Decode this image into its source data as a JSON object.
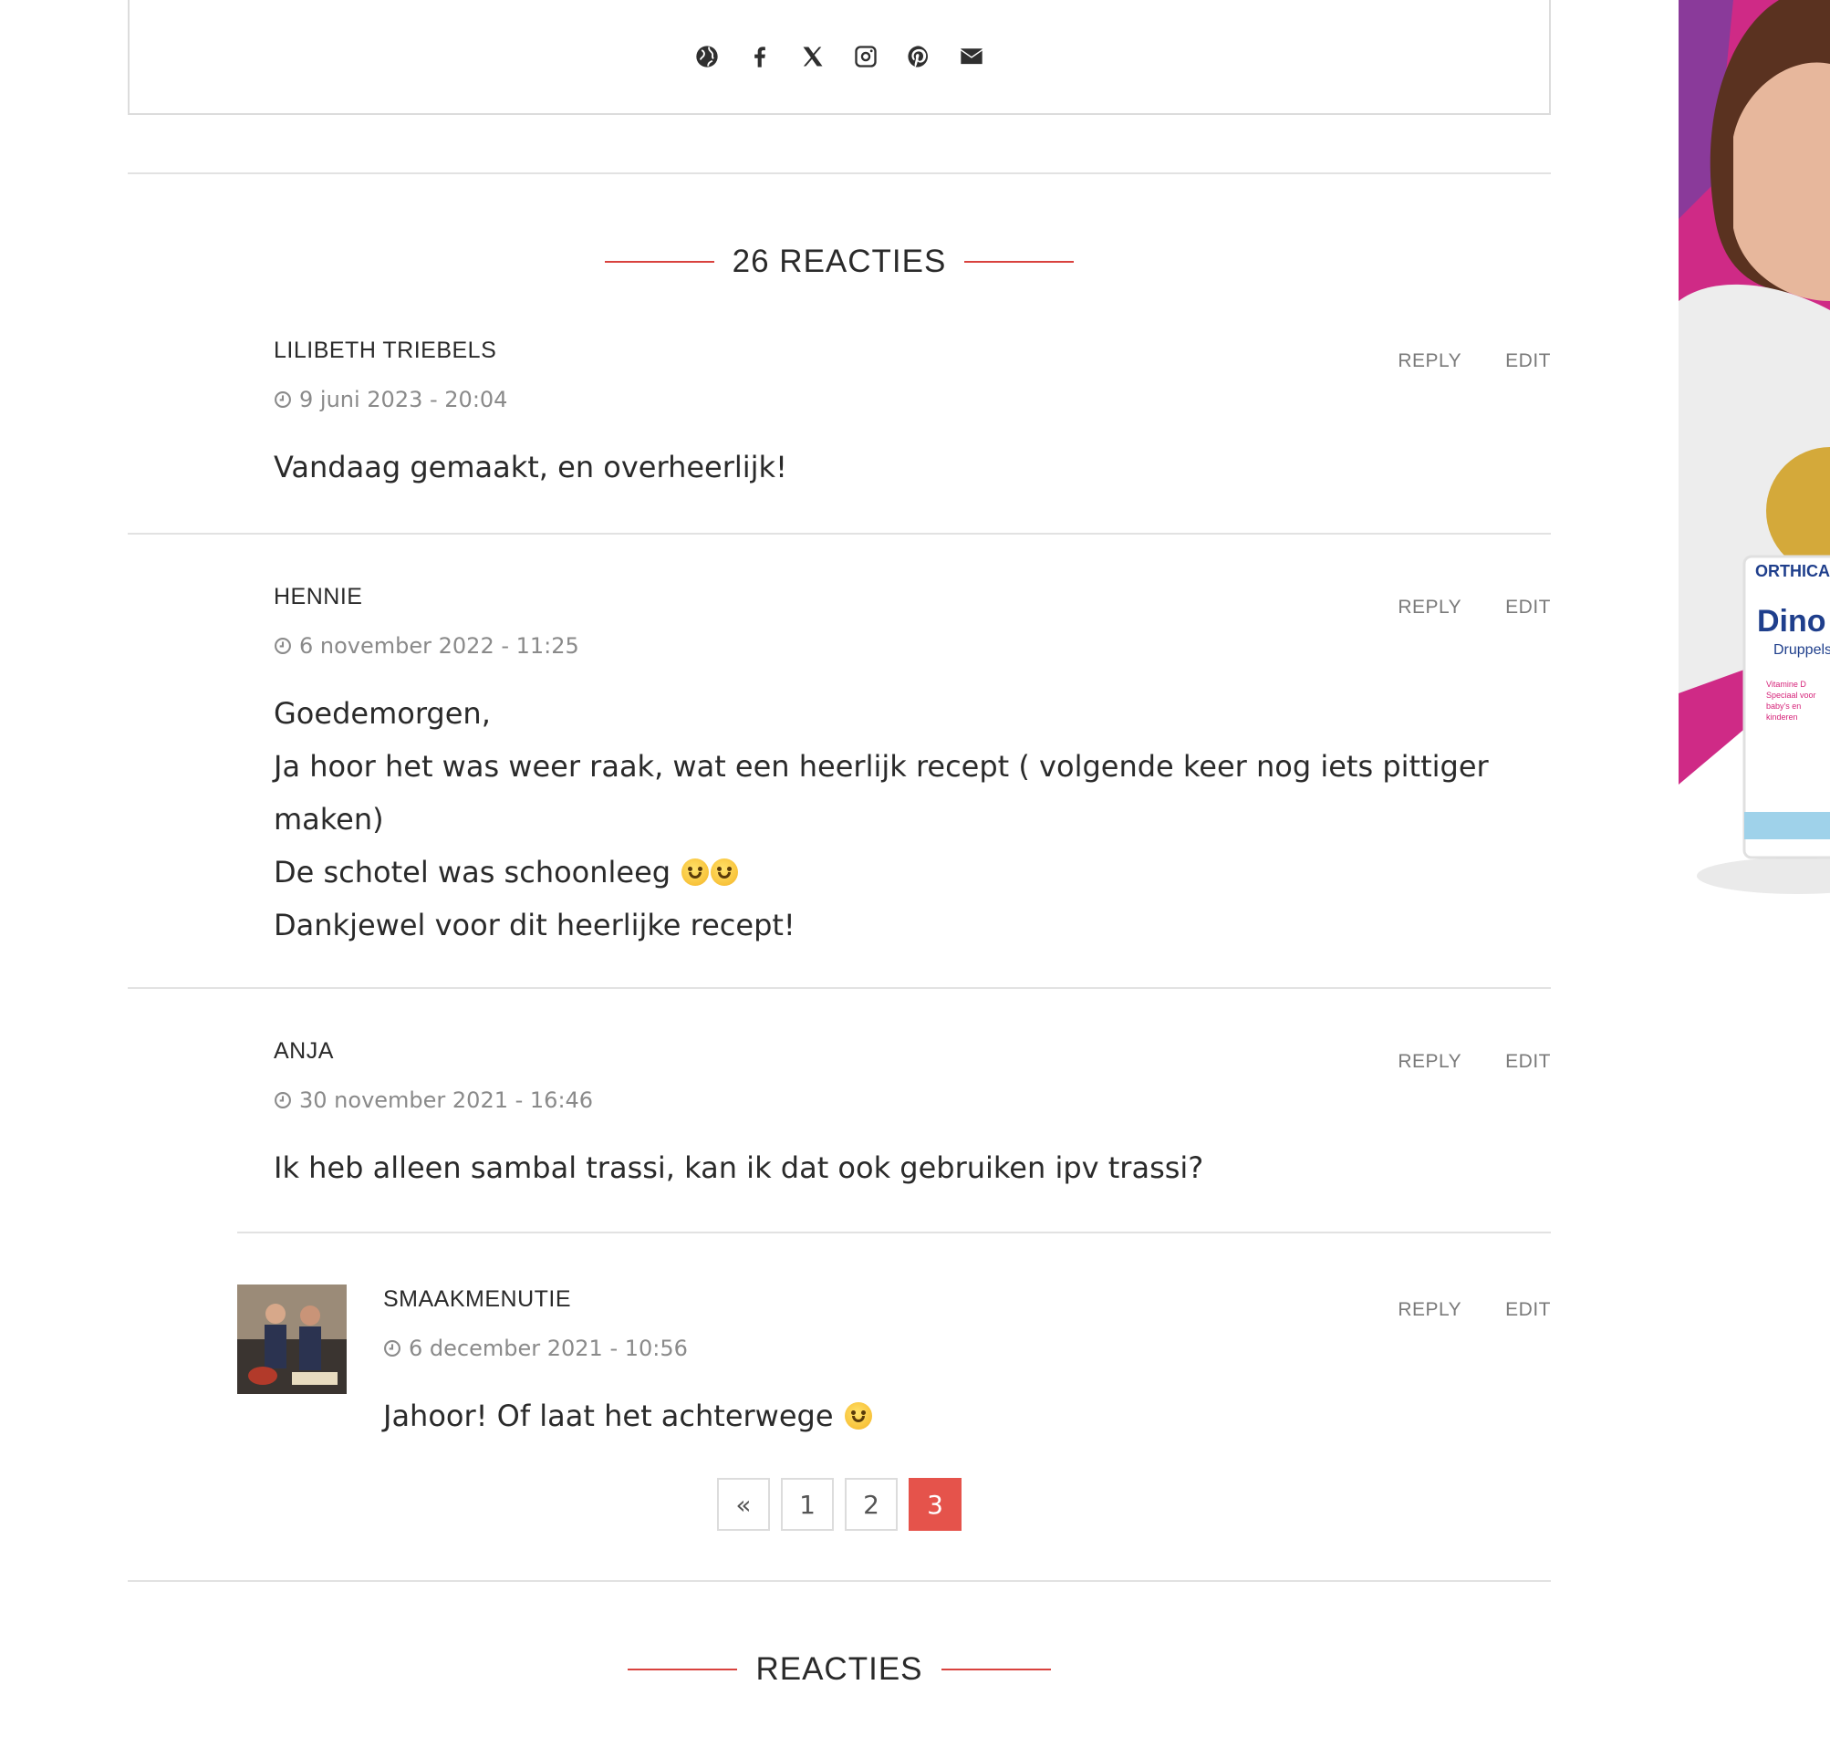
{
  "share": {
    "icons": [
      "globe-icon",
      "facebook-icon",
      "x-icon",
      "instagram-icon",
      "pinterest-icon",
      "envelope-icon"
    ]
  },
  "comments_section": {
    "title": "26 REACTIES"
  },
  "comments": [
    {
      "author": "LILIBETH TRIEBELS",
      "date": "9 juni 2023 - 20:04",
      "reply": "REPLY",
      "edit": "EDIT",
      "body": [
        "Vandaag gemaakt, en overheerlijk!"
      ]
    },
    {
      "author": "HENNIE",
      "date": "6 november 2022 - 11:25",
      "reply": "REPLY",
      "edit": "EDIT",
      "body": [
        "Goedemorgen,",
        "Ja hoor het was weer raak, wat een heerlijk recept ( volgende keer nog iets pittiger",
        "maken)",
        "De schotel was schoonleeg",
        "Dankjewel voor dit heerlijke recept!"
      ]
    },
    {
      "author": "ANJA",
      "date": "30 november 2021 - 16:46",
      "reply": "REPLY",
      "edit": "EDIT",
      "body": [
        "Ik heb alleen sambal trassi, kan ik dat ook gebruiken ipv trassi?"
      ]
    },
    {
      "author": "SMAAKMENUTIE",
      "date": "6 december 2021 - 10:56",
      "reply": "REPLY",
      "edit": "EDIT",
      "body": [
        "Jahoor! Of laat het achterwege"
      ]
    }
  ],
  "pagination": {
    "prev": "«",
    "pages": [
      "1",
      "2",
      "3"
    ],
    "current": "3"
  },
  "form_section": {
    "title": "REACTIES"
  },
  "ad": {
    "brand": "ORTHICA",
    "product": "Dino D",
    "subtitle": "Druppels",
    "tag": "Vitamine D Speciaal voor baby's en kinderen",
    "accent": "#d6247a"
  },
  "colors": {
    "accent_red": "#d9423e",
    "active_page": "#e5534b"
  }
}
